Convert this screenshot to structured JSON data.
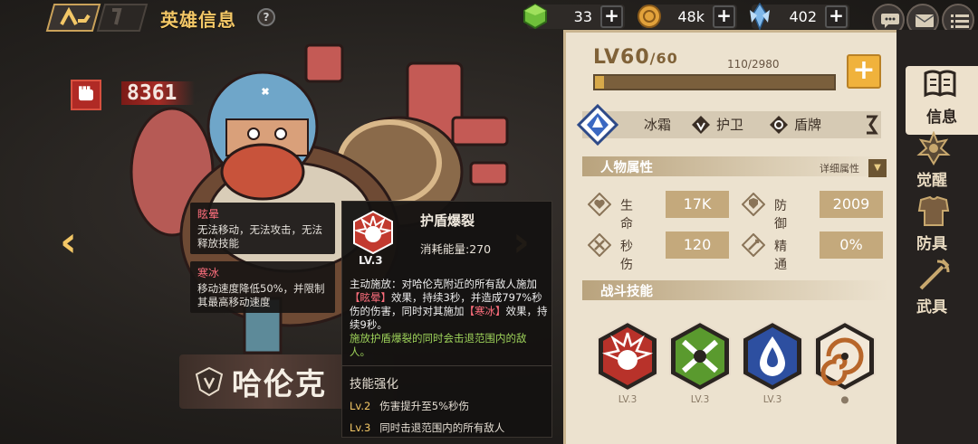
{
  "header": {
    "title": "英雄信息",
    "help_glyph": "?"
  },
  "resources": [
    {
      "name": "green-gem",
      "value": "33"
    },
    {
      "name": "gold-coin",
      "value": "48k"
    },
    {
      "name": "blue-crystal",
      "value": "402"
    }
  ],
  "hero": {
    "power": "8361",
    "name": "哈伦克"
  },
  "effects": [
    {
      "name": "眩晕",
      "desc": "无法移动，无法攻击，无法释放技能"
    },
    {
      "name": "寒冰",
      "desc": "移动速度降低50%，并限制其最高移动速度"
    }
  ],
  "popup": {
    "skill_name": "护盾爆裂",
    "level": "LV.3",
    "cost": "消耗能量:270",
    "desc_pre": "主动施放：对哈伦克附近的所有敌人施加",
    "desc_tag1": "【眩晕】",
    "desc_mid": "效果，持续3秒，并造成797%秒伤的伤害，同时对其施加",
    "desc_tag2": "【寒冰】",
    "desc_post": "效果，持续9秒。",
    "green": "施放护盾爆裂的同时会击退范围内的敌人。",
    "enhance_title": "技能强化",
    "enhancements": [
      {
        "lv": "Lv.2",
        "text": "伤害提升至5%秒伤"
      },
      {
        "lv": "Lv.3",
        "text": "同时击退范围内的所有敌人"
      }
    ]
  },
  "level": {
    "current": "LV60",
    "max": "/60",
    "exp": "110/2980",
    "exp_fraction": 0.037,
    "plus": "+"
  },
  "tags": [
    "冰霜",
    "护卫",
    "盾牌"
  ],
  "attributes": {
    "title": "人物属性",
    "detail_label": "详细属性",
    "stats": [
      {
        "label": "生命",
        "value": "17K",
        "icon": "heart-icon"
      },
      {
        "label": "防御",
        "value": "2009",
        "icon": "shield-icon"
      },
      {
        "label": "秒伤",
        "value": "120",
        "icon": "sword-icon"
      },
      {
        "label": "精通",
        "value": "0%",
        "icon": "mastery-icon"
      }
    ]
  },
  "skills": {
    "title": "战斗技能",
    "list": [
      {
        "name": "shield-burst",
        "level": "LV.3",
        "color": "#b8322a"
      },
      {
        "name": "bone-spin",
        "level": "LV.3",
        "color": "#5a9a2e"
      },
      {
        "name": "water-drop",
        "level": "LV.3",
        "color": "#2d4fa0"
      },
      {
        "name": "drill-spiral",
        "level": "",
        "color": "#b8662a"
      }
    ]
  },
  "sidenav": [
    {
      "label": "信息",
      "icon": "book-icon",
      "active": true
    },
    {
      "label": "觉醒",
      "icon": "awaken-icon",
      "active": false
    },
    {
      "label": "防具",
      "icon": "armor-icon",
      "active": false
    },
    {
      "label": "武具",
      "icon": "weapon-icon",
      "active": false
    }
  ]
}
